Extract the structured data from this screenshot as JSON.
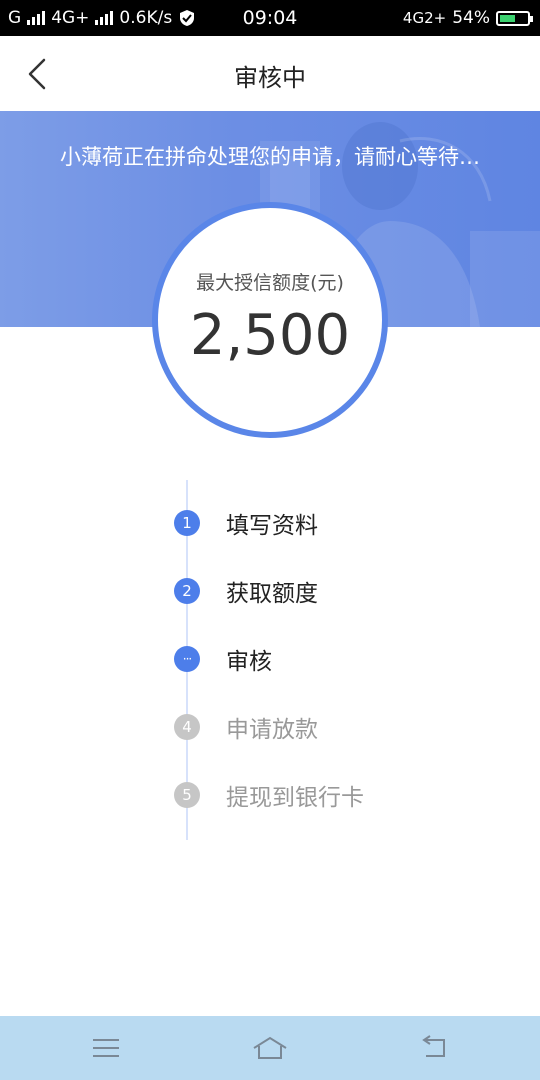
{
  "status_bar": {
    "carrier1": "G",
    "network": "4G+",
    "speed": "0.6K/s",
    "time": "09:04",
    "network_right": "4G2+",
    "battery": "54%"
  },
  "header": {
    "title": "审核中",
    "back_icon": "chevron-left-icon"
  },
  "banner": {
    "message": "小薄荷正在拼命处理您的申请，请耐心等待…"
  },
  "credit": {
    "label": "最大授信额度(元)",
    "amount": "2,500"
  },
  "steps": [
    {
      "index": "1",
      "label": "填写资料",
      "state": "done"
    },
    {
      "index": "2",
      "label": "获取额度",
      "state": "done"
    },
    {
      "index": "···",
      "label": "审核",
      "state": "current"
    },
    {
      "index": "4",
      "label": "申请放款",
      "state": "pending"
    },
    {
      "index": "5",
      "label": "提现到银行卡",
      "state": "pending"
    }
  ],
  "nav_bar": {
    "menu_icon": "menu-icon",
    "home_icon": "home-icon",
    "back_icon": "back-arrow-icon"
  },
  "colors": {
    "accent": "#5a86e8",
    "banner": "#6d8fe4",
    "muted": "#c6c6c6",
    "nav_bg": "#b9daf1"
  }
}
